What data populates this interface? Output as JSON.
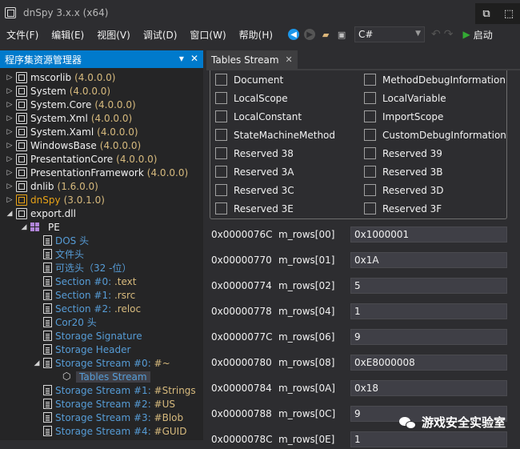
{
  "window": {
    "title": "dnSpy 3.x.x (x64)"
  },
  "menu": [
    "文件(F)",
    "编辑(E)",
    "视图(V)",
    "调试(D)",
    "窗口(W)",
    "帮助(H)"
  ],
  "toolbar": {
    "language": "C#",
    "run_label": "启动"
  },
  "explorer": {
    "title": "程序集资源管理器",
    "assemblies": [
      {
        "name": "mscorlib",
        "version": "(4.0.0.0)"
      },
      {
        "name": "System",
        "version": "(4.0.0.0)"
      },
      {
        "name": "System.Core",
        "version": "(4.0.0.0)"
      },
      {
        "name": "System.Xml",
        "version": "(4.0.0.0)"
      },
      {
        "name": "System.Xaml",
        "version": "(4.0.0.0)"
      },
      {
        "name": "WindowsBase",
        "version": "(4.0.0.0)"
      },
      {
        "name": "PresentationCore",
        "version": "(4.0.0.0)"
      },
      {
        "name": "PresentationFramework",
        "version": "(4.0.0.0)"
      },
      {
        "name": "dnlib",
        "version": "(1.6.0.0)"
      },
      {
        "name": "dnSpy",
        "version": "(3.0.1.0)"
      },
      {
        "name": "export.dll",
        "version": ""
      }
    ],
    "pe_label": "PE",
    "pe_children": [
      {
        "label": "DOS 头",
        "suffix": ""
      },
      {
        "label": "文件头",
        "suffix": ""
      },
      {
        "label": "可选头（32 -位）",
        "suffix": ""
      },
      {
        "label": "Section #0: ",
        "suffix": ".text"
      },
      {
        "label": "Section #1: ",
        "suffix": ".rsrc"
      },
      {
        "label": "Section #2: ",
        "suffix": ".reloc"
      },
      {
        "label": "Cor20 头",
        "suffix": ""
      },
      {
        "label": "Storage Signature",
        "suffix": ""
      },
      {
        "label": "Storage Header",
        "suffix": ""
      },
      {
        "label": "Storage Stream #0: ",
        "suffix": "#~"
      }
    ],
    "tables_stream": "Tables Stream",
    "more_streams": [
      {
        "label": "Storage Stream #1: ",
        "suffix": "#Strings"
      },
      {
        "label": "Storage Stream #2: ",
        "suffix": "#US"
      },
      {
        "label": "Storage Stream #3: ",
        "suffix": "#Blob"
      },
      {
        "label": "Storage Stream #4: ",
        "suffix": "#GUID"
      }
    ]
  },
  "tab": {
    "label": "Tables Stream"
  },
  "checkboxes": [
    [
      "Document",
      "MethodDebugInformation"
    ],
    [
      "LocalScope",
      "LocalVariable"
    ],
    [
      "LocalConstant",
      "ImportScope"
    ],
    [
      "StateMachineMethod",
      "CustomDebugInformation"
    ],
    [
      "Reserved 38",
      "Reserved 39"
    ],
    [
      "Reserved 3A",
      "Reserved 3B"
    ],
    [
      "Reserved 3C",
      "Reserved 3D"
    ],
    [
      "Reserved 3E",
      "Reserved 3F"
    ]
  ],
  "rows": [
    {
      "offset": "0x0000076C",
      "name": "m_rows[00]",
      "value": "0x1000001"
    },
    {
      "offset": "0x00000770",
      "name": "m_rows[01]",
      "value": "0x1A"
    },
    {
      "offset": "0x00000774",
      "name": "m_rows[02]",
      "value": "5"
    },
    {
      "offset": "0x00000778",
      "name": "m_rows[04]",
      "value": "1"
    },
    {
      "offset": "0x0000077C",
      "name": "m_rows[06]",
      "value": "9"
    },
    {
      "offset": "0x00000780",
      "name": "m_rows[08]",
      "value": "0xE8000008"
    },
    {
      "offset": "0x00000784",
      "name": "m_rows[0A]",
      "value": "0x18"
    },
    {
      "offset": "0x00000788",
      "name": "m_rows[0C]",
      "value": "9"
    },
    {
      "offset": "0x0000078C",
      "name": "m_rows[0E]",
      "value": "1"
    }
  ],
  "watermark": {
    "text": "游戏安全实验室"
  }
}
